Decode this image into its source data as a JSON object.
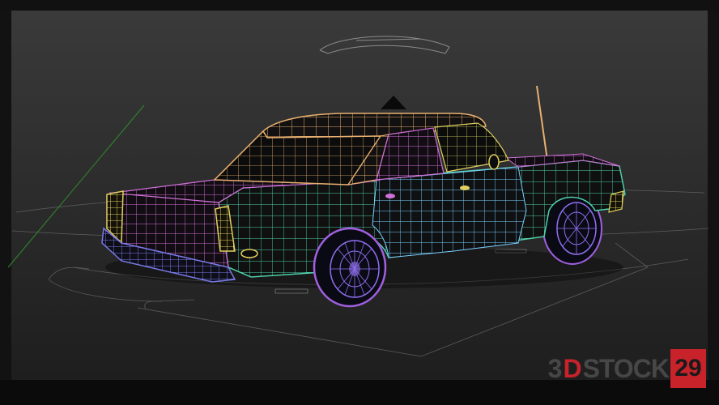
{
  "scene": {
    "subject": "car-wireframe",
    "colors": {
      "roof": "#e8b070",
      "body": "#4fd0a8",
      "side": "#7ad0ff",
      "rear_panel": "#d070d8",
      "trim": "#e0d060",
      "bumper": "#7a7ae8",
      "wheel": "#9070f0",
      "tire": "#a060e0",
      "grid": "#7a7a7a"
    }
  },
  "watermark": {
    "prefix": "3",
    "accent": "D",
    "suffix": "STOCK",
    "badge": "29"
  }
}
